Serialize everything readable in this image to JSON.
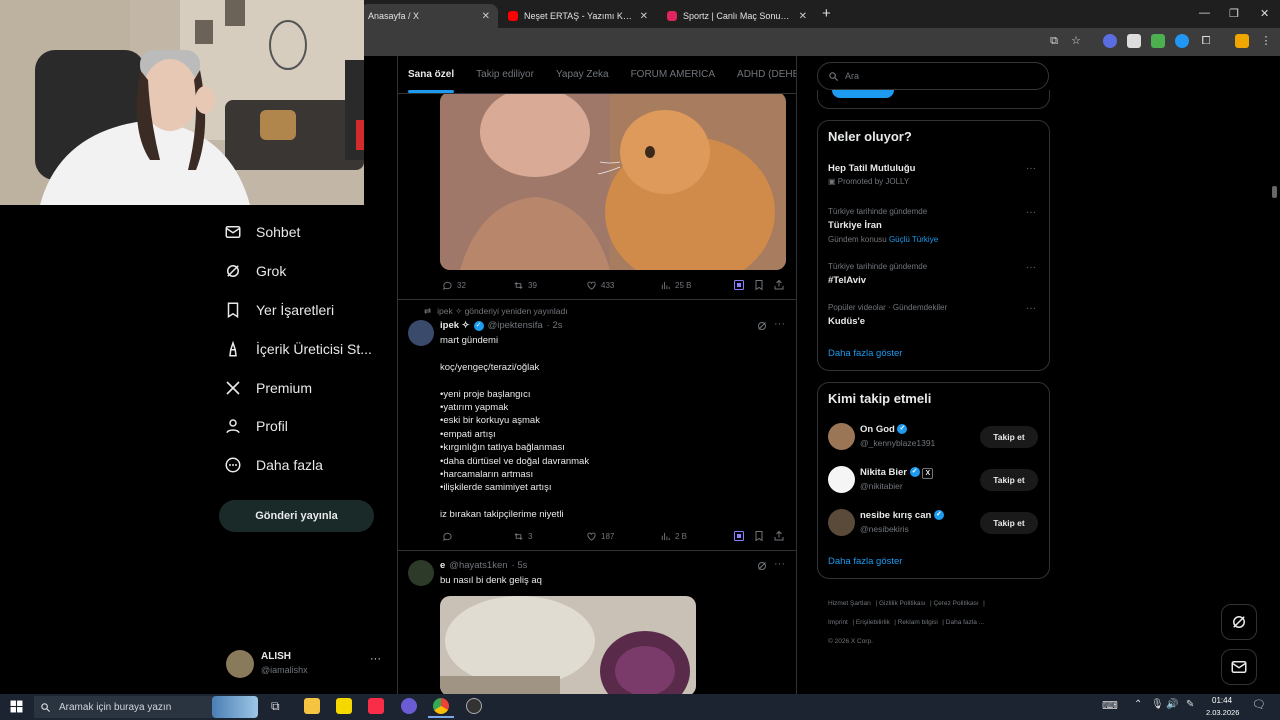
{
  "browser": {
    "tabs": [
      {
        "title": "Anasayfa / X",
        "active": true
      },
      {
        "title": "Neşet ERTAŞ - Yazımı Kışa Çevirdin",
        "active": false
      },
      {
        "title": "Sportz | Canlı Maç Sonuçları ve",
        "active": false
      }
    ],
    "new_tab": "+",
    "win_minimize": "—",
    "win_restore": "❐",
    "win_close": "✕"
  },
  "nav": {
    "items": [
      {
        "label": "Sohbet",
        "icon": "mail-icon"
      },
      {
        "label": "Grok",
        "icon": "grok-icon"
      },
      {
        "label": "Yer İşaretleri",
        "icon": "bookmark-icon"
      },
      {
        "label": "İçerik Üreticisi St...",
        "icon": "creator-studio-icon"
      },
      {
        "label": "Premium",
        "icon": "x-logo-icon"
      },
      {
        "label": "Profil",
        "icon": "profile-icon"
      },
      {
        "label": "Daha fazla",
        "icon": "more-circle-icon"
      }
    ],
    "post_button": "Gönderi yayınla",
    "account": {
      "name": "ALISH",
      "handle": "@iamalishx",
      "menu": "···"
    }
  },
  "main": {
    "tabs": [
      "Sana özel",
      "Takip ediliyor",
      "Yapay Zeka",
      "FORUM AMERICA",
      "ADHD (DEHB)"
    ],
    "tweet1": {
      "replies": "32",
      "reposts": "39",
      "likes": "433",
      "views": "25 B"
    },
    "tweet2": {
      "repost_note": "ipek ✧ gönderiyi yeniden yayınladı",
      "name": "ipek ✧",
      "handle": "@ipektensifa",
      "time": "· 2s",
      "text": "mart gündemi\n\nkoç/yengeç/terazi/oğlak\n\n•yeni proje başlangıcı\n•yatırım yapmak\n•eski bir korkuyu aşmak\n•empati artışı\n•kırgınlığın tatlıya bağlanması\n•daha dürtüsel ve doğal davranmak\n•harcamaların artması\n•ilişkilerde samimiyet artışı\n\niz bırakan takipçilerime niyetli",
      "replies": "",
      "reposts": "3",
      "likes": "187",
      "views": "2 B"
    },
    "tweet3": {
      "name": "e",
      "handle": "@hayats1ken",
      "time": "· 5s",
      "text": "bu nasıl bi denk geliş aq"
    }
  },
  "sidebar": {
    "search_placeholder": "Ara",
    "trends": {
      "title": "Neler oluyor?",
      "items": [
        {
          "sub": "",
          "title": "Hep Tatil Mutluluğu",
          "extra": "Promoted by JOLLY"
        },
        {
          "sub": "Türkiye tarihinde gündemde",
          "title": "Türkiye İran",
          "extra": "Gündem konusu",
          "extra_link": "Güçlü Türkiye"
        },
        {
          "sub": "Türkiye tarihinde gündemde",
          "title": "#TelAviv",
          "extra": ""
        },
        {
          "sub": "Popüler videolar · Gündemdekiler",
          "title": "Kudüs'e",
          "extra": ""
        }
      ],
      "show_more": "Daha fazla göster"
    },
    "who_to_follow": {
      "title": "Kimi takip etmeli",
      "users": [
        {
          "name": "On God",
          "handle": "@_kennyblaze1391",
          "button": "Takip et"
        },
        {
          "name": "Nikita Bier",
          "handle": "@nikitabier",
          "button": "Takip et"
        },
        {
          "name": "nesibe kırış can",
          "handle": "@nesibekiris",
          "button": "Takip et"
        }
      ],
      "show_more": "Daha fazla göster"
    },
    "footer": {
      "links": [
        "Hizmet Şartları",
        "Gizlilik Politikası",
        "Çerez Politikası",
        "Imprint",
        "Erişilebilirlik",
        "Reklam bilgisi",
        "Daha fazla ..."
      ],
      "copyright": "© 2026 X Corp."
    }
  },
  "taskbar": {
    "search_placeholder": "Aramak için buraya yazın",
    "time": "01:44",
    "date": "2.03.2026"
  },
  "colors": {
    "accent": "#1d9bf0",
    "bg": "#000000",
    "border": "#2f3336",
    "muted": "#71767b"
  }
}
